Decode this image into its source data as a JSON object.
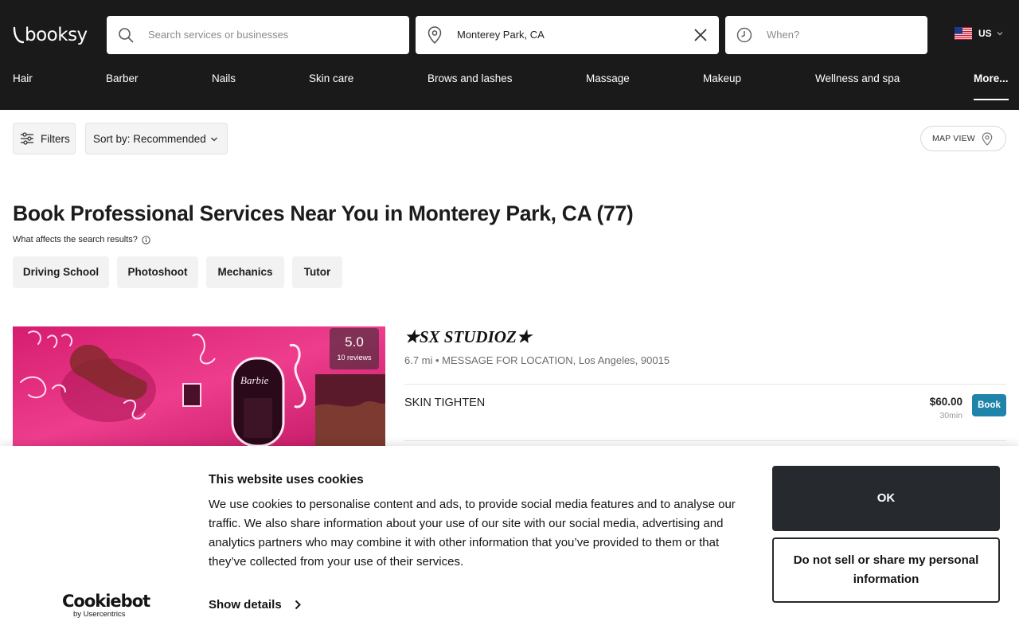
{
  "header": {
    "logo": "booksy",
    "search_placeholder": "Search services or businesses",
    "location_value": "Monterey Park, CA",
    "when_placeholder": "When?",
    "country": "US"
  },
  "categories": [
    {
      "label": "Hair"
    },
    {
      "label": "Barber"
    },
    {
      "label": "Nails"
    },
    {
      "label": "Skin care"
    },
    {
      "label": "Brows and lashes"
    },
    {
      "label": "Massage"
    },
    {
      "label": "Makeup"
    },
    {
      "label": "Wellness and spa"
    },
    {
      "label": "More..."
    }
  ],
  "toolbar": {
    "filters_label": "Filters",
    "sort_label": "Sort by: Recommended",
    "map_label": "MAP VIEW"
  },
  "main": {
    "title": "Book Professional Services Near You in Monterey Park, CA (77)",
    "affects_label": "What affects the search results?",
    "chips": [
      "Driving School",
      "Photoshoot",
      "Mechanics",
      "Tutor"
    ]
  },
  "result": {
    "name": "★SX STUDIOZ★",
    "address": "6.7 mi • MESSAGE FOR LOCATION, Los Angeles, 90015",
    "rating": "5.0",
    "reviews": "10 reviews",
    "service": {
      "name": "SKIN TIGHTEN",
      "price": "$60.00",
      "duration": "30min",
      "book_label": "Book"
    }
  },
  "cookie_banner": {
    "brand": "Cookiebot",
    "brand_by": "by Usercentrics",
    "title": "This website uses cookies",
    "text": "We use cookies to personalise content and ads, to provide social media features and to analyse our traffic. We also share information about your use of our site with our social media, advertising and analytics partners who may combine it with other information that you’ve provided to them or that they’ve collected from your use of their services.",
    "details_label": "Show details",
    "ok_label": "OK",
    "dns_label": "Do not sell or share my personal information"
  },
  "colors": {
    "header_bg": "#1a1a1a",
    "book_button": "#1f84a9",
    "ok_button": "#262a2f",
    "photo_accent": "#e0257a"
  }
}
